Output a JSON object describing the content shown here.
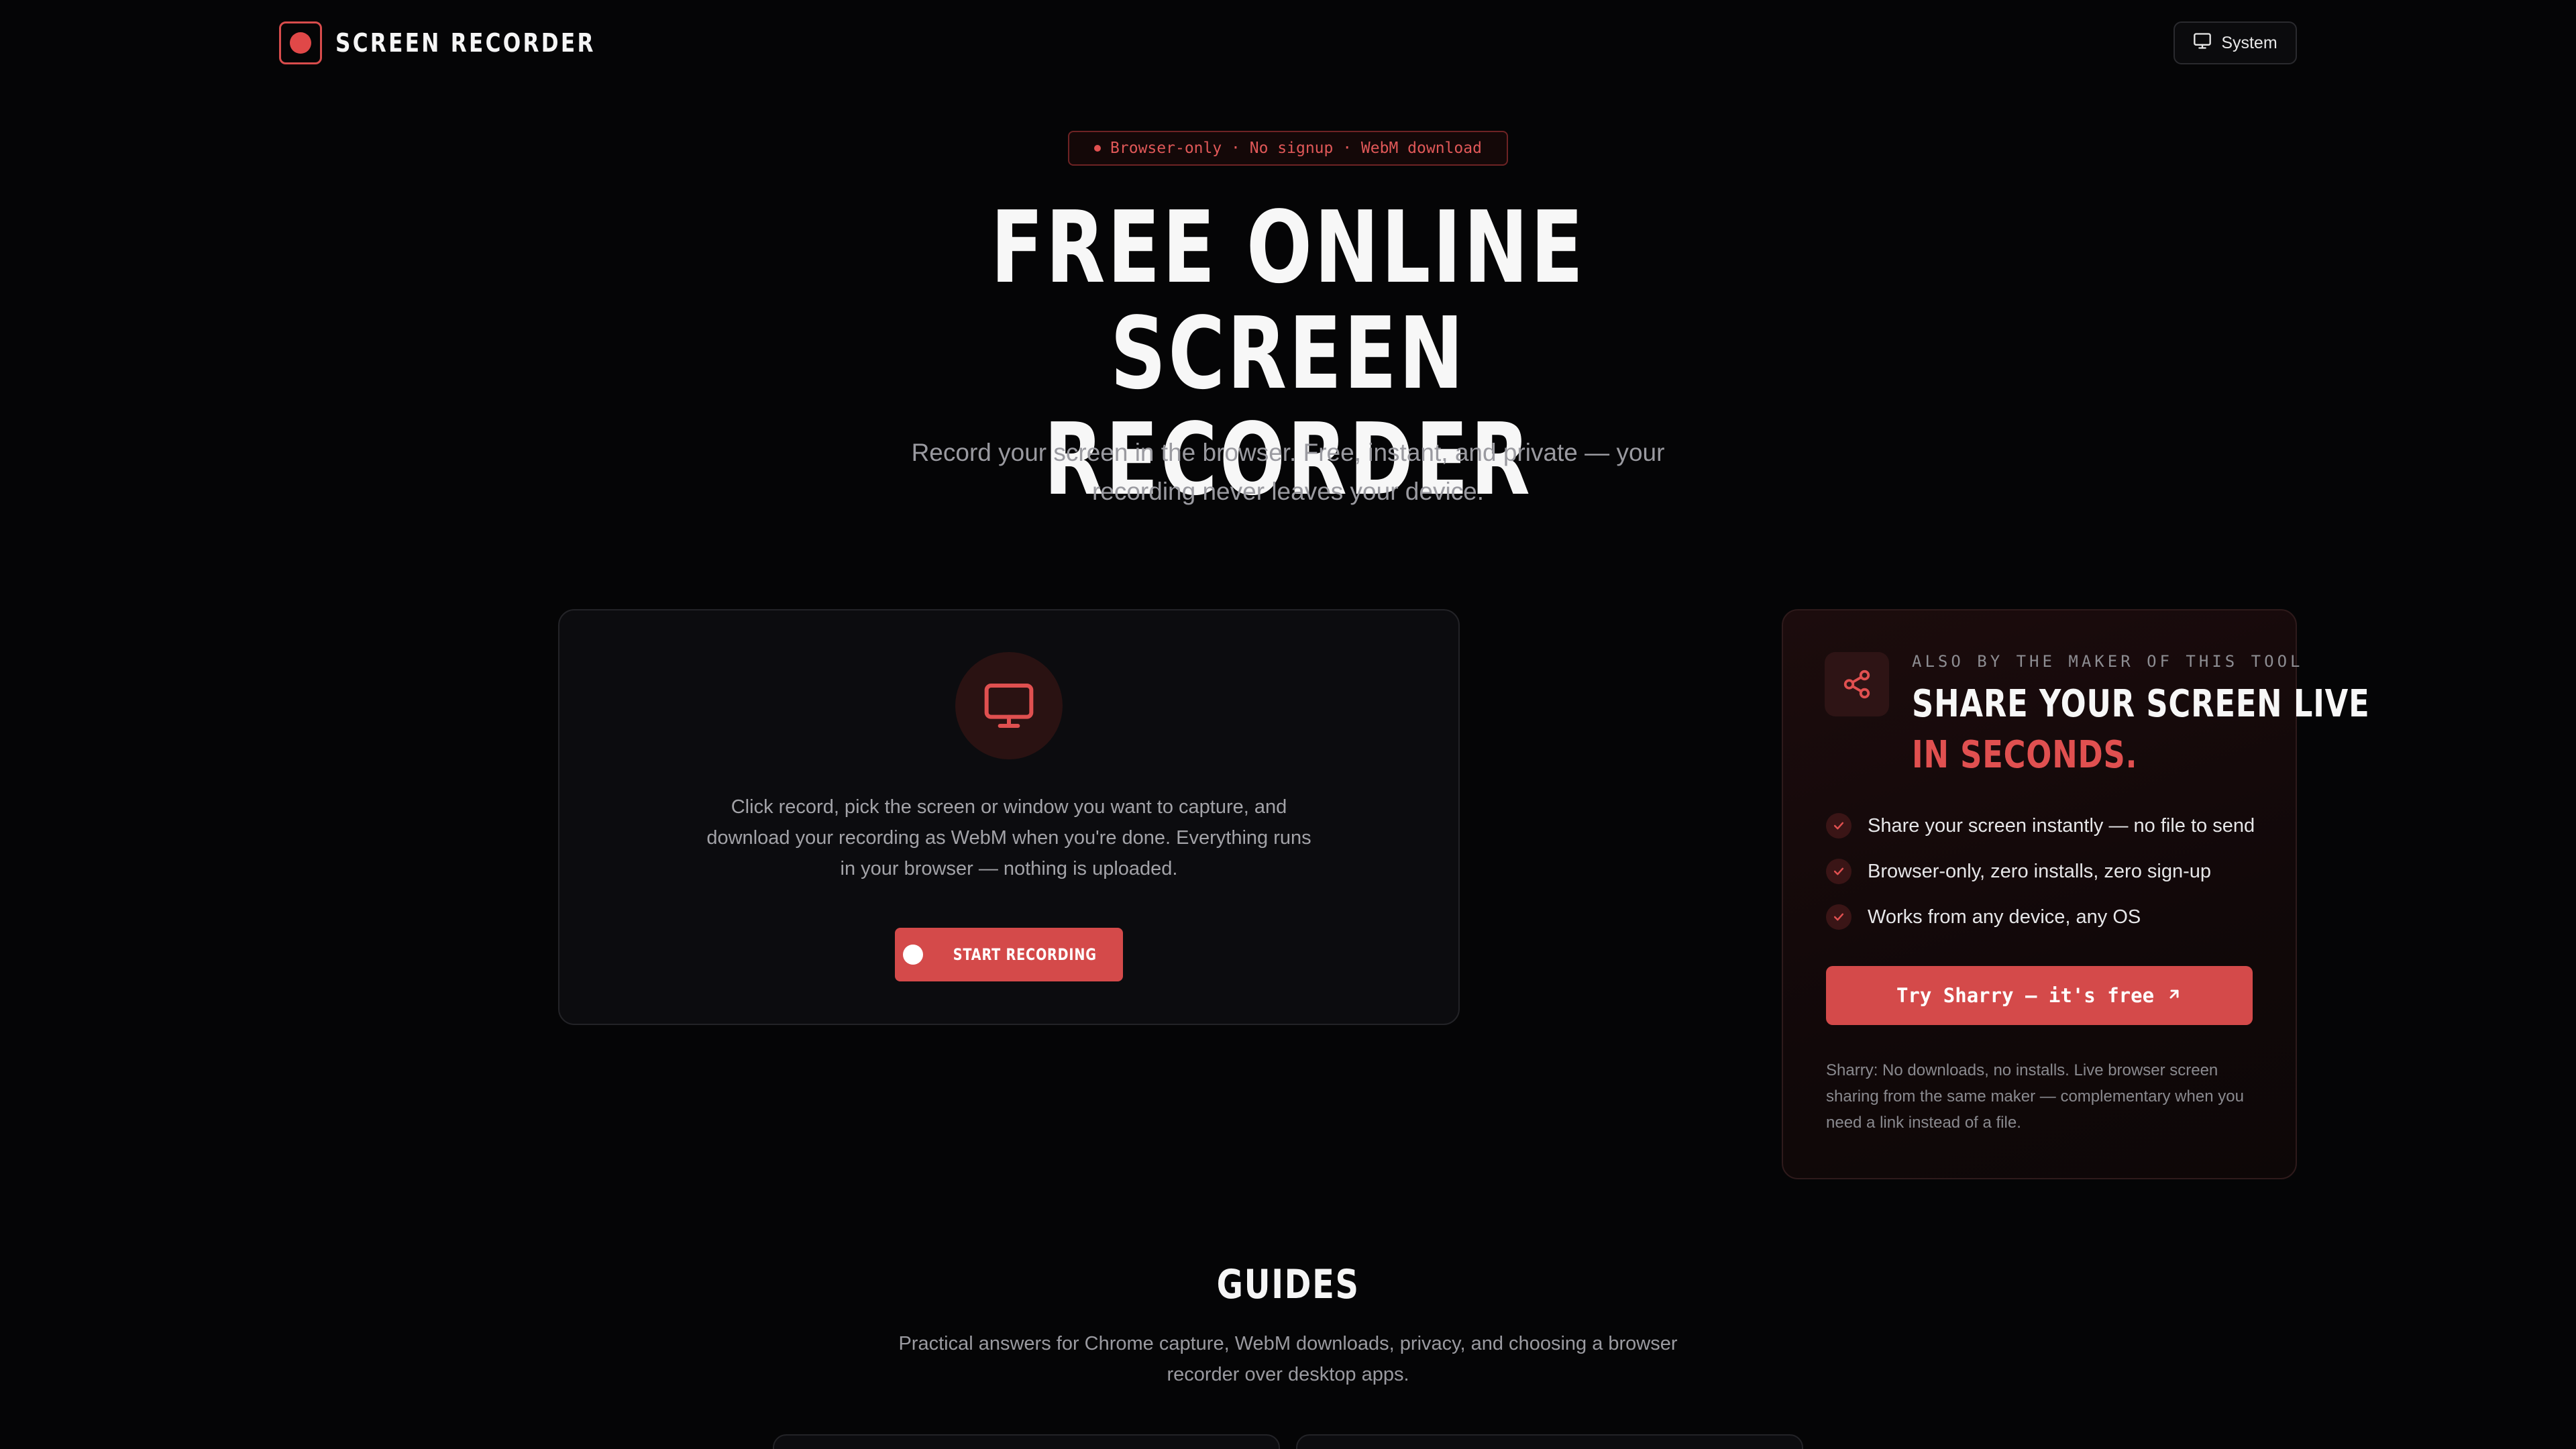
{
  "header": {
    "app_name": "SCREEN RECORDER",
    "theme_button_label": "System"
  },
  "hero": {
    "pill_text": "Browser-only · No signup · WebM download",
    "title_line1": "FREE ONLINE",
    "title_line2": "SCREEN RECORDER",
    "subtitle": "Record your screen in the browser. Free, instant, and private — your recording never leaves your device."
  },
  "recorder": {
    "description": "Click record, pick the screen or window you want to capture, and download your recording as WebM when you're done. Everything runs in your browser — nothing is uploaded.",
    "start_button_label": "START RECORDING"
  },
  "promo": {
    "kicker": "ALSO BY THE MAKER OF THIS TOOL",
    "title_line1": "SHARE YOUR SCREEN LIVE",
    "title_line2": "IN SECONDS.",
    "features": [
      "Share your screen instantly — no file to send",
      "Browser-only, zero installs, zero sign-up",
      "Works from any device, any OS"
    ],
    "cta_label": "Try Sharry — it's free",
    "note": "Sharry: No downloads, no installs. Live browser screen sharing from the same maker — complementary when you need a link instead of a file."
  },
  "guides": {
    "title": "GUIDES",
    "subtitle": "Practical answers for Chrome capture, WebM downloads, privacy, and choosing a browser recorder over desktop apps."
  },
  "colors": {
    "accent": "#d44a4a",
    "background": "#050506"
  }
}
